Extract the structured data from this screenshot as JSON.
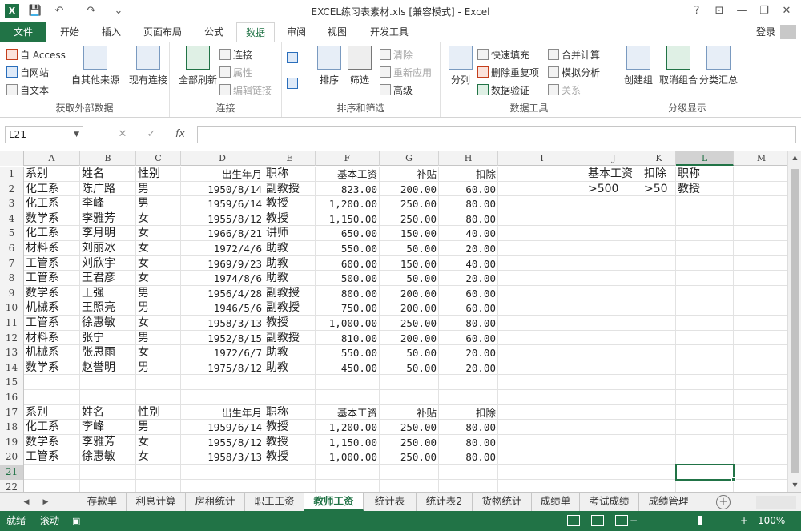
{
  "window": {
    "title": "EXCEL练习表素材.xls  [兼容模式] - Excel",
    "help": "?",
    "ribbon_display": "⊡",
    "minimize": "—",
    "restore": "❐",
    "close": "✕"
  },
  "qat": {
    "save": "💾",
    "undo": "↶",
    "redo": "↷",
    "customize": "⌄"
  },
  "tabs": [
    {
      "label": "文件"
    },
    {
      "label": "开始"
    },
    {
      "label": "插入"
    },
    {
      "label": "页面布局"
    },
    {
      "label": "公式"
    },
    {
      "label": "数据"
    },
    {
      "label": "审阅"
    },
    {
      "label": "视图"
    },
    {
      "label": "开发工具"
    }
  ],
  "login": "登录",
  "ribbon": {
    "get_external": {
      "label": "获取外部数据",
      "access": "自 Access",
      "web": "自网站",
      "text": "自文本",
      "other": "自其他来源",
      "existing": "现有连接"
    },
    "connections": {
      "label": "连接",
      "refresh_all": "全部刷新",
      "connections": "连接",
      "properties": "属性",
      "edit_links": "编辑链接"
    },
    "sort_filter": {
      "label": "排序和筛选",
      "sort": "排序",
      "filter": "筛选",
      "clear": "清除",
      "reapply": "重新应用",
      "advanced": "高级"
    },
    "data_tools": {
      "label": "数据工具",
      "text_to_columns": "分列",
      "flash_fill": "快速填充",
      "remove_dup": "删除重复项",
      "validation": "数据验证",
      "consolidate": "合并计算",
      "what_if": "模拟分析",
      "relationships": "关系"
    },
    "outline": {
      "label": "分级显示",
      "group": "创建组",
      "ungroup": "取消组合",
      "subtotal": "分类汇总"
    }
  },
  "formula_bar": {
    "name_box": "L21",
    "cancel": "✕",
    "enter": "✓",
    "fx": "fx",
    "formula": ""
  },
  "columns": [
    "A",
    "B",
    "C",
    "D",
    "E",
    "F",
    "G",
    "H",
    "I",
    "J",
    "K",
    "L",
    "M"
  ],
  "rows": [
    {
      "n": "1",
      "c": [
        "系别",
        "姓名",
        "性别",
        "出生年月",
        "职称",
        "基本工资",
        "补贴",
        "扣除",
        "",
        "基本工资",
        "扣除",
        "职称",
        ""
      ]
    },
    {
      "n": "2",
      "c": [
        "化工系",
        "陈广路",
        "男",
        "1950/8/14",
        "副教授",
        "823.00",
        "200.00",
        "60.00",
        "",
        ">500",
        ">50",
        "教授",
        ""
      ]
    },
    {
      "n": "3",
      "c": [
        "化工系",
        "李峰",
        "男",
        "1959/6/14",
        "教授",
        "1,200.00",
        "250.00",
        "80.00",
        "",
        "",
        "",
        "",
        ""
      ]
    },
    {
      "n": "4",
      "c": [
        "数学系",
        "李雅芳",
        "女",
        "1955/8/12",
        "教授",
        "1,150.00",
        "250.00",
        "80.00",
        "",
        "",
        "",
        "",
        ""
      ]
    },
    {
      "n": "5",
      "c": [
        "化工系",
        "李月明",
        "女",
        "1966/8/21",
        "讲师",
        "650.00",
        "150.00",
        "40.00",
        "",
        "",
        "",
        "",
        ""
      ]
    },
    {
      "n": "6",
      "c": [
        "材料系",
        "刘丽冰",
        "女",
        "1972/4/6",
        "助教",
        "550.00",
        "50.00",
        "20.00",
        "",
        "",
        "",
        "",
        ""
      ]
    },
    {
      "n": "7",
      "c": [
        "工管系",
        "刘欣宇",
        "女",
        "1969/9/23",
        "助教",
        "600.00",
        "150.00",
        "40.00",
        "",
        "",
        "",
        "",
        ""
      ]
    },
    {
      "n": "8",
      "c": [
        "工管系",
        "王君彦",
        "女",
        "1974/8/6",
        "助教",
        "500.00",
        "50.00",
        "20.00",
        "",
        "",
        "",
        "",
        ""
      ]
    },
    {
      "n": "9",
      "c": [
        "数学系",
        "王强",
        "男",
        "1956/4/28",
        "副教授",
        "800.00",
        "200.00",
        "60.00",
        "",
        "",
        "",
        "",
        ""
      ]
    },
    {
      "n": "10",
      "c": [
        "机械系",
        "王照亮",
        "男",
        "1946/5/6",
        "副教授",
        "750.00",
        "200.00",
        "60.00",
        "",
        "",
        "",
        "",
        ""
      ]
    },
    {
      "n": "11",
      "c": [
        "工管系",
        "徐惠敏",
        "女",
        "1958/3/13",
        "教授",
        "1,000.00",
        "250.00",
        "80.00",
        "",
        "",
        "",
        "",
        ""
      ]
    },
    {
      "n": "12",
      "c": [
        "材料系",
        "张宁",
        "男",
        "1952/8/15",
        "副教授",
        "810.00",
        "200.00",
        "60.00",
        "",
        "",
        "",
        "",
        ""
      ]
    },
    {
      "n": "13",
      "c": [
        "机械系",
        "张思雨",
        "女",
        "1972/6/7",
        "助教",
        "550.00",
        "50.00",
        "20.00",
        "",
        "",
        "",
        "",
        ""
      ]
    },
    {
      "n": "14",
      "c": [
        "数学系",
        "赵誉明",
        "男",
        "1975/8/12",
        "助教",
        "450.00",
        "50.00",
        "20.00",
        "",
        "",
        "",
        "",
        ""
      ]
    },
    {
      "n": "15",
      "c": [
        "",
        "",
        "",
        "",
        "",
        "",
        "",
        "",
        "",
        "",
        "",
        "",
        ""
      ]
    },
    {
      "n": "16",
      "c": [
        "",
        "",
        "",
        "",
        "",
        "",
        "",
        "",
        "",
        "",
        "",
        "",
        ""
      ]
    },
    {
      "n": "17",
      "c": [
        "系别",
        "姓名",
        "性别",
        "出生年月",
        "职称",
        "基本工资",
        "补贴",
        "扣除",
        "",
        "",
        "",
        "",
        ""
      ]
    },
    {
      "n": "18",
      "c": [
        "化工系",
        "李峰",
        "男",
        "1959/6/14",
        "教授",
        "1,200.00",
        "250.00",
        "80.00",
        "",
        "",
        "",
        "",
        ""
      ]
    },
    {
      "n": "19",
      "c": [
        "数学系",
        "李雅芳",
        "女",
        "1955/8/12",
        "教授",
        "1,150.00",
        "250.00",
        "80.00",
        "",
        "",
        "",
        "",
        ""
      ]
    },
    {
      "n": "20",
      "c": [
        "工管系",
        "徐惠敏",
        "女",
        "1958/3/13",
        "教授",
        "1,000.00",
        "250.00",
        "80.00",
        "",
        "",
        "",
        "",
        ""
      ]
    },
    {
      "n": "21",
      "c": [
        "",
        "",
        "",
        "",
        "",
        "",
        "",
        "",
        "",
        "",
        "",
        "",
        ""
      ]
    },
    {
      "n": "22",
      "c": [
        "",
        "",
        "",
        "",
        "",
        "",
        "",
        "",
        "",
        "",
        "",
        "",
        ""
      ]
    }
  ],
  "sheets": [
    {
      "label": "存款单"
    },
    {
      "label": "利息计算"
    },
    {
      "label": "房租统计"
    },
    {
      "label": "职工工资"
    },
    {
      "label": "教师工资"
    },
    {
      "label": "统计表"
    },
    {
      "label": "统计表2"
    },
    {
      "label": "货物统计"
    },
    {
      "label": "成绩单"
    },
    {
      "label": "考试成绩"
    },
    {
      "label": "成绩管理"
    }
  ],
  "status": {
    "ready": "就绪",
    "scroll": "滚动",
    "zoom": "100%",
    "zoom_minus": "−",
    "zoom_plus": "+"
  }
}
